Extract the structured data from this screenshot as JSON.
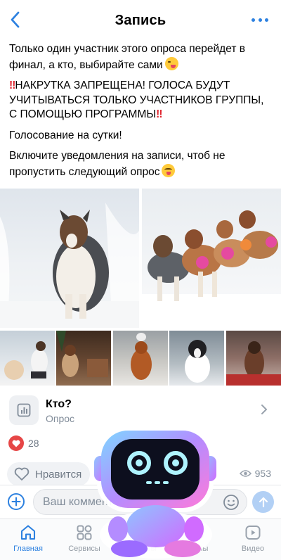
{
  "header": {
    "title": "Запись",
    "back_icon": "chevron-left-icon",
    "more_icon": "more-horizontal-icon",
    "accent_color": "#2d81e0"
  },
  "post": {
    "line1": "Только один участник этого опроса перейдет в финал, а кто, выбирайте сами",
    "line1_emoji": "winking-tongue-emoji",
    "warning_marks": "‼️",
    "warning_text": "НАКРУТКА ЗАПРЕЩЕНА! ГОЛОСА БУДУТ УЧИТЫВАТЬСЯ ТОЛЬКО УЧАСТНИКОВ ГРУППЫ, С ПОМОЩЬЮ ПРОГРАММЫ",
    "voting": "Голосование на сутки!",
    "notify": "Включите уведомления на записи, чтоб не пропустить следующий опрос",
    "notify_emoji": "yum-face-emoji"
  },
  "photos": {
    "main": [
      "photo-dog-in-snow",
      "photo-dog-team-with-bows"
    ],
    "thumbnails": [
      "photo-girl-with-dog",
      "photo-dog-with-gifts",
      "photo-red-dog-snow",
      "photo-black-white-dog",
      "photo-dog-christmas"
    ]
  },
  "poll": {
    "title": "Кто?",
    "subtitle": "Опрос",
    "icon": "poll-chart-icon"
  },
  "reactions": {
    "count": "28",
    "icon": "heart-icon",
    "color": "#e64646"
  },
  "actions": {
    "like_label": "Нравится",
    "views": "953"
  },
  "composer": {
    "placeholder": "Ваш комментарий",
    "send_color": "#b2d0f5"
  },
  "tabbar": {
    "items": [
      {
        "label": "Главная",
        "icon": "home-icon",
        "active": true
      },
      {
        "label": "Сервисы",
        "icon": "services-grid-icon",
        "active": false
      },
      {
        "label": "Маркеты",
        "icon": "market-icon",
        "active": false
      },
      {
        "label": "Клипы",
        "icon": "clips-icon",
        "active": false
      },
      {
        "label": "Видео",
        "icon": "video-icon",
        "active": false
      }
    ]
  }
}
